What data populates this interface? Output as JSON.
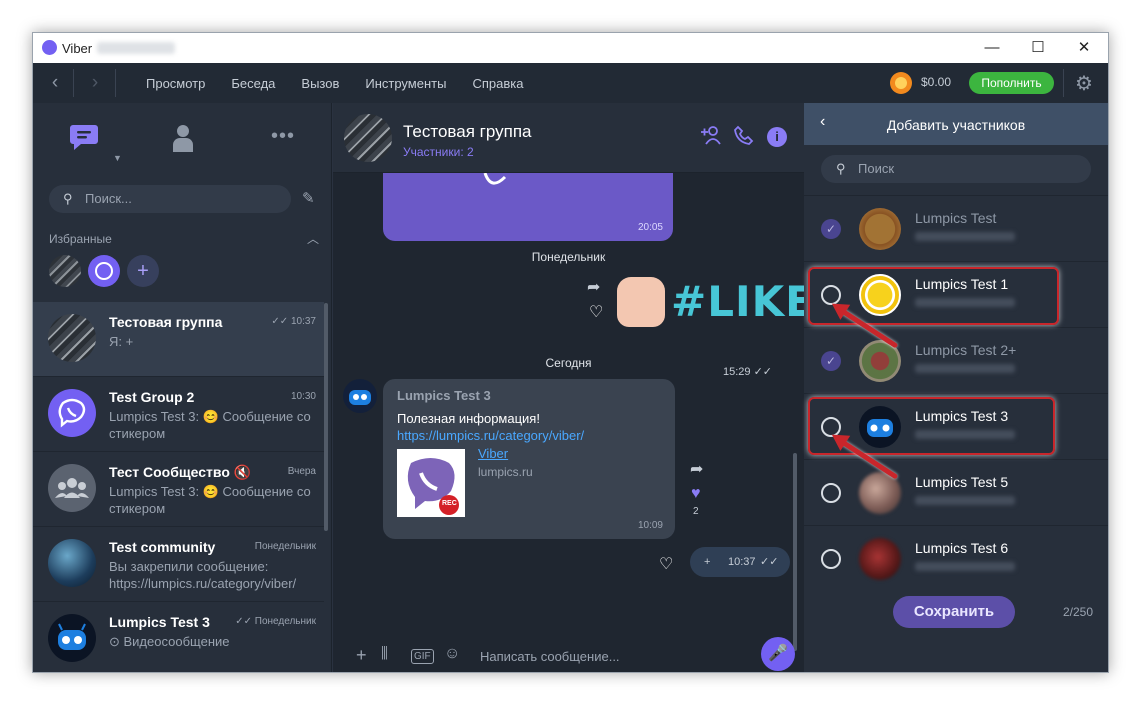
{
  "titlebar": {
    "title": "Viber",
    "min": "—",
    "max": "☐",
    "close": "✕"
  },
  "menubar": {
    "items": [
      "Просмотр",
      "Беседа",
      "Вызов",
      "Инструменты",
      "Справка"
    ],
    "balance": "$0.00",
    "topup": "Пополнить"
  },
  "left": {
    "search_placeholder": "Поиск...",
    "favorites_title": "Избранные",
    "chats": [
      {
        "name": "Тестовая группа",
        "time": "10:37",
        "preview": "Я: +",
        "active": true
      },
      {
        "name": "Test Group 2",
        "time": "10:30",
        "preview": "Lumpics Test 3: 😊 Сообщение со стикером"
      },
      {
        "name": "Тест Сообщество",
        "time": "Вчера",
        "preview": "Lumpics Test 3: 😊 Сообщение со стикером"
      },
      {
        "name": "Test community",
        "time": "Понедельник",
        "preview": "Вы закрепили сообщение: https://lumpics.ru/category/viber/"
      },
      {
        "name": "Lumpics Test 3",
        "time": "Понедельник",
        "preview": "⊙ Видеосообщение"
      }
    ]
  },
  "conversation": {
    "title": "Тестовая группа",
    "subtitle": "Участники: 2",
    "top_bubble_time": "20:05",
    "date_monday": "Понедельник",
    "sticker_time": "15:29",
    "sticker_text": "#LIKE",
    "date_today": "Сегодня",
    "message": {
      "sender": "Lumpics Test 3",
      "text": "Полезная информация! ",
      "link": "https://lumpics.ru/category/viber/",
      "preview_title": "Viber",
      "preview_domain": "lumpics.ru",
      "preview_badge": "REC",
      "time": "10:09",
      "reaction_count": "2"
    },
    "outgoing": {
      "text": "+",
      "time": "10:37"
    },
    "composer_placeholder": "Написать сообщение..."
  },
  "add_members": {
    "title": "Добавить участников",
    "search_placeholder": "Поиск",
    "contacts": [
      {
        "name": "Lumpics Test",
        "checked": true,
        "disabled": true
      },
      {
        "name": "Lumpics Test 1",
        "checked": false,
        "disabled": false
      },
      {
        "name": "Lumpics Test 2+",
        "checked": true,
        "disabled": true
      },
      {
        "name": "Lumpics Test 3",
        "checked": false,
        "disabled": false
      },
      {
        "name": "Lumpics Test 5",
        "checked": false,
        "disabled": false
      },
      {
        "name": "Lumpics Test 6",
        "checked": false,
        "disabled": false
      }
    ],
    "save": "Сохранить",
    "count": "2/250"
  },
  "colors": {
    "accent": "#7360f2",
    "topup": "#3cb53f",
    "annotation": "#c9262b"
  }
}
